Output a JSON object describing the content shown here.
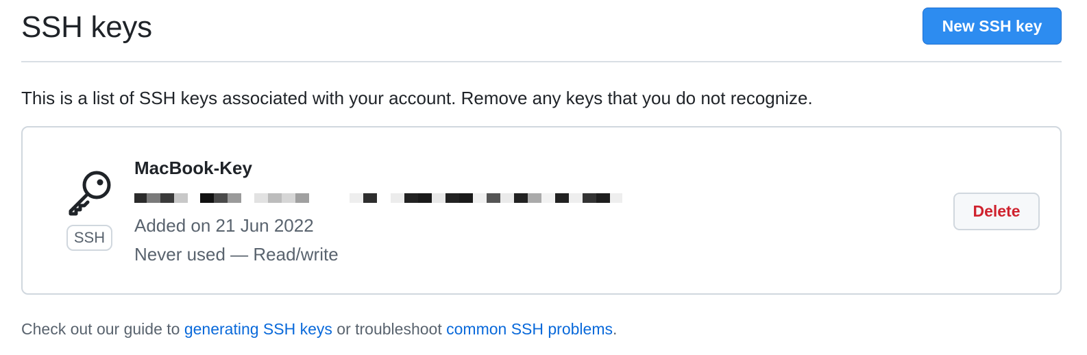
{
  "header": {
    "title": "SSH keys",
    "new_key_label": "New SSH key"
  },
  "intro_text": "This is a list of SSH keys associated with your account. Remove any keys that you do not recognize.",
  "keys": [
    {
      "icon": "key-icon",
      "type_badge": "SSH",
      "title": "MacBook-Key",
      "fingerprint_redacted": true,
      "added": "Added on 21 Jun 2022",
      "usage": "Never used — Read/write",
      "delete_label": "Delete"
    }
  ],
  "footer": {
    "prefix": "Check out our guide to ",
    "link1": "generating SSH keys",
    "middle": " or troubleshoot ",
    "link2": "common SSH problems",
    "suffix": "."
  },
  "colors": {
    "primary_button": "#2d8cf0",
    "danger": "#cf222e",
    "link": "#0969da",
    "muted_text": "#59636e",
    "border": "#d0d7de"
  }
}
